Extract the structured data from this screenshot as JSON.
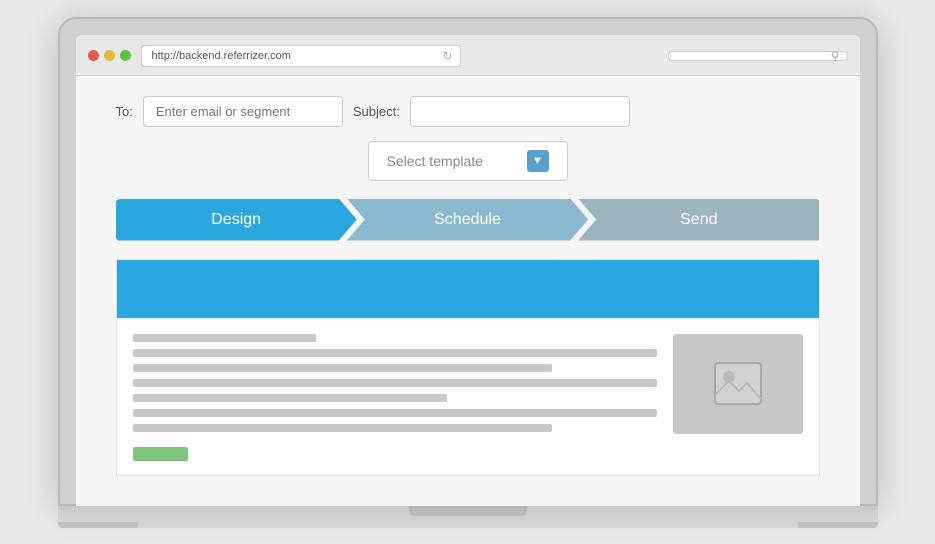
{
  "browser": {
    "url": "http://backend.referrizer.com",
    "url_placeholder": "",
    "search_placeholder": ""
  },
  "form": {
    "to_label": "To:",
    "to_placeholder": "Enter email or segment",
    "subject_label": "Subject:",
    "subject_value": ""
  },
  "template_select": {
    "label": "Select template",
    "chevron": "▼"
  },
  "steps": [
    {
      "id": "design",
      "label": "Design"
    },
    {
      "id": "schedule",
      "label": "Schedule"
    },
    {
      "id": "send",
      "label": "Send"
    }
  ],
  "preview": {
    "header_color": "#29a8e0",
    "image_placeholder_label": "image"
  },
  "icons": {
    "refresh": "↻",
    "search": "🔍",
    "image": "🖼"
  }
}
